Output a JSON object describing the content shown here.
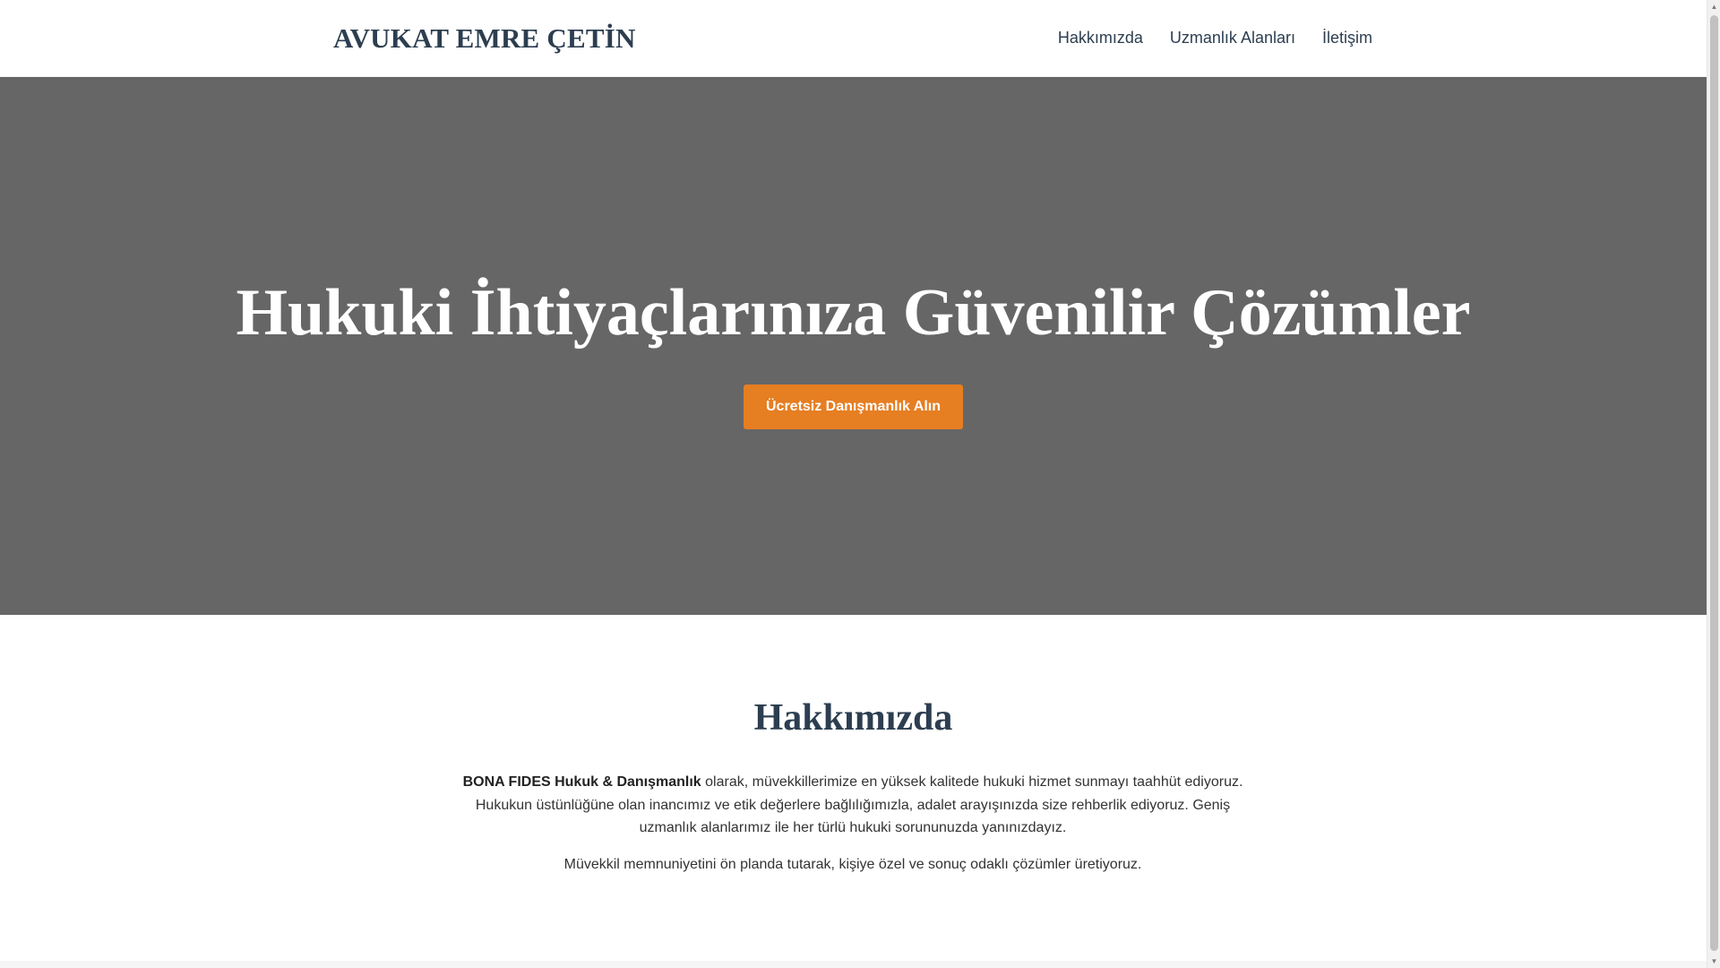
{
  "header": {
    "logo": "AVUKAT EMRE ÇETİN",
    "nav": [
      {
        "label": "Hakkımızda"
      },
      {
        "label": "Uzmanlık Alanları"
      },
      {
        "label": "İletişim"
      }
    ]
  },
  "hero": {
    "title": "Hukuki İhtiyaçlarınıza Güvenilir Çözümler",
    "cta_label": "Ücretsiz Danışmanlık Alın"
  },
  "about": {
    "title": "Hakkımızda",
    "firm_name": "BONA FIDES Hukuk & Danışmanlık",
    "paragraph1_rest": " olarak, müvekkillerimize en yüksek kalitede hukuki hizmet sunmayı taahhüt ediyoruz. Hukukun üstünlüğüne olan inancımız ve etik değerlere bağlılığımızla, adalet arayışınızda size rehberlik ediyoruz. Geniş uzmanlık alanlarımız ile her türlü hukuki sorununuzda yanınızdayız.",
    "paragraph2": "Müvekkil memnuniyetini ön planda tutarak, kişiye özel ve sonuç odaklı çözümler üretiyoruz."
  },
  "scrollbar": {
    "up_icon": "triangle-up",
    "down_icon": "triangle-down"
  },
  "colors": {
    "brand_dark": "#2c3e50",
    "accent": "#e67e22",
    "hero_bg": "#666666"
  }
}
